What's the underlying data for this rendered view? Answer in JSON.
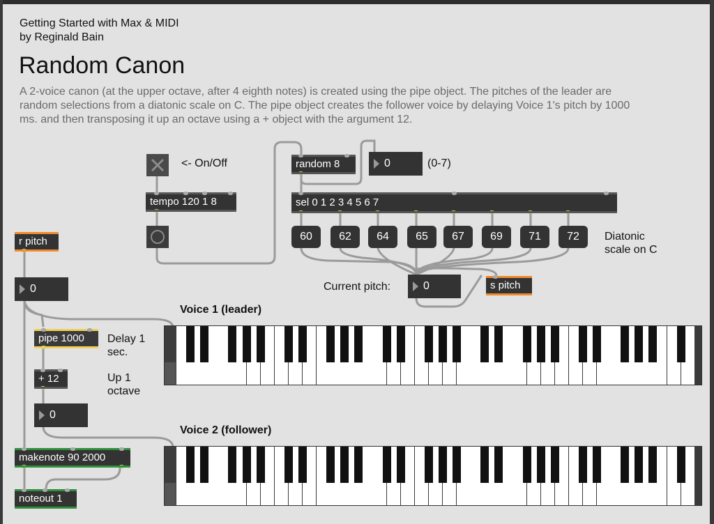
{
  "header": {
    "line1": "Getting Started with Max & MIDI",
    "line2": "by Reginald Bain",
    "title": "Random Canon",
    "description": "A 2-voice canon (at the upper octave, after 4 eighth notes) is created using the pipe object. The pitches of the leader are random selections from a diatonic scale on C. The pipe object creates the follower voice by delaying Voice 1's pitch by 1000 ms. and then transposing it up an octave using a + object with the argument 12."
  },
  "labels": {
    "onoff": "<- On/Off",
    "range": "(0-7)",
    "diatonic": "Diatonic",
    "scale_on_c": "scale on C",
    "current_pitch": "Current pitch:",
    "voice1": "Voice 1 (leader)",
    "voice2": "Voice 2 (follower)",
    "delay1": "Delay 1",
    "delay2": "sec.",
    "up1": "Up 1",
    "up2": "octave"
  },
  "objects": {
    "tempo": "tempo 120 1 8",
    "random": "random 8",
    "sel": "sel 0 1 2 3 4 5 6 7",
    "spitch": "s pitch",
    "rpitch": "r pitch",
    "pipe": "pipe 1000",
    "plus": "+ 12",
    "makenote": "makenote 90 2000",
    "noteout": "noteout 1"
  },
  "numbers": {
    "random_out": "0",
    "current_pitch": "0",
    "rpitch_out": "0",
    "plus_out": "0"
  },
  "messages": [
    "60",
    "62",
    "64",
    "65",
    "67",
    "69",
    "71",
    "72"
  ],
  "colors": {
    "canvas": "#e2e2e2",
    "object": "#333333",
    "send_receive": "#f08a2c",
    "pipe_accent": "#f2cf5b",
    "midi_accent": "#2f8f3a",
    "cable": "#9a9a9a"
  },
  "icons": {
    "toggle": "x-toggle-icon",
    "bang": "circle-bang-icon",
    "number": "triangle-number-icon"
  }
}
